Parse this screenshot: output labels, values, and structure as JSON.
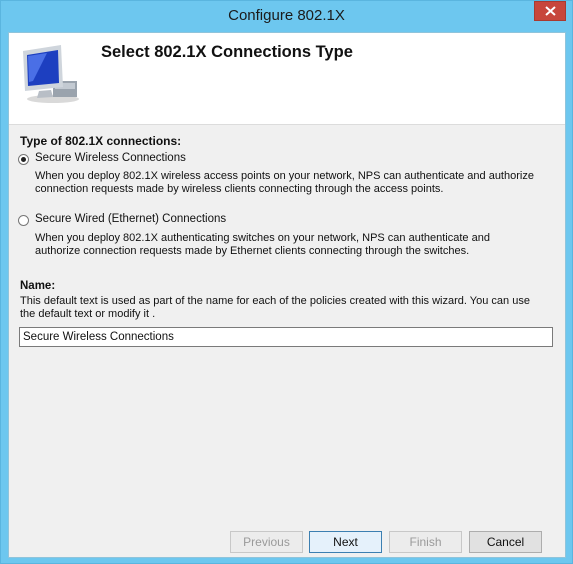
{
  "window": {
    "title": "Configure 802.1X"
  },
  "header": {
    "title": "Select 802.1X Connections Type",
    "icon": "monitor-network-icon"
  },
  "connection_type": {
    "label": "Type of 802.1X connections:",
    "options": [
      {
        "label": "Secure Wireless Connections",
        "selected": true,
        "description": "When you deploy 802.1X wireless access points on your network, NPS can authenticate and authorize connection requests made by wireless clients connecting through the access points."
      },
      {
        "label": "Secure Wired (Ethernet) Connections",
        "selected": false,
        "description": "When you deploy 802.1X authenticating switches on your network, NPS can authenticate and authorize connection requests made by Ethernet clients connecting through the switches."
      }
    ]
  },
  "name": {
    "label": "Name:",
    "help": "This default text is used as part of the name for each of the policies created with this wizard. You can use the default text or modify it .",
    "value": "Secure Wireless Connections"
  },
  "buttons": {
    "previous": "Previous",
    "next": "Next",
    "finish": "Finish",
    "cancel": "Cancel"
  }
}
